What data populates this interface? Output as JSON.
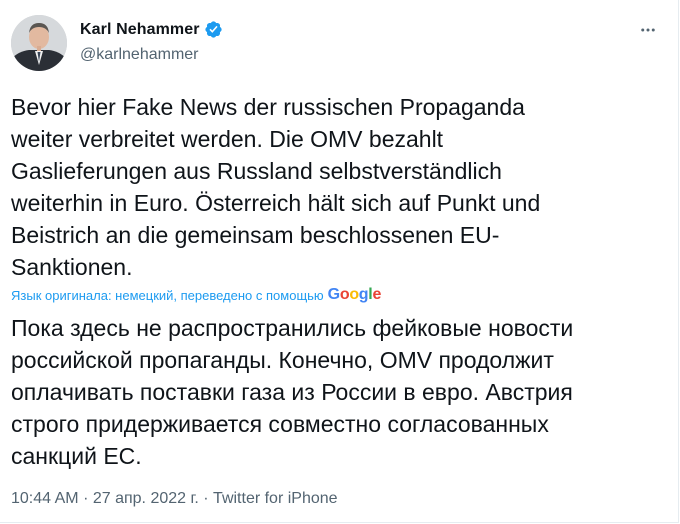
{
  "author": {
    "name": "Karl Nehammer",
    "handle": "@karlnehammer",
    "verified": true
  },
  "tweet": {
    "text": "Bevor hier Fake News der russischen Propaganda\nweiter verbreitet werden. Die OMV bezahlt\nGaslieferungen aus Russland selbstverständlich\nweiterhin in Euro. Österreich hält sich auf Punkt und\nBeistrich an die gemeinsam beschlossenen EU-\nSanktionen.",
    "translated_by_label": "Язык оригинала: немецкий, переведено с помощью",
    "translation_provider": "Google",
    "translation": "Пока здесь не распространились фейковые новости\nроссийской пропаганды. Конечно, OMV продолжит\nоплачивать поставки газа из России в евро. Австрия\nстрого придерживается совместно согласованных\nсанкций ЕС."
  },
  "meta": {
    "time": "10:44 AM",
    "separator": "·",
    "date": "27 апр. 2022 г.",
    "source": "Twitter for iPhone"
  },
  "icons": {
    "verified": "verified-badge-icon",
    "more": "more-options-icon"
  },
  "colors": {
    "accent": "#1d9bf0",
    "text": "#0f1419",
    "secondary": "#536471",
    "google_blue": "#4285f4",
    "google_red": "#ea4335",
    "google_yellow": "#fbbc05",
    "google_green": "#34a853"
  }
}
